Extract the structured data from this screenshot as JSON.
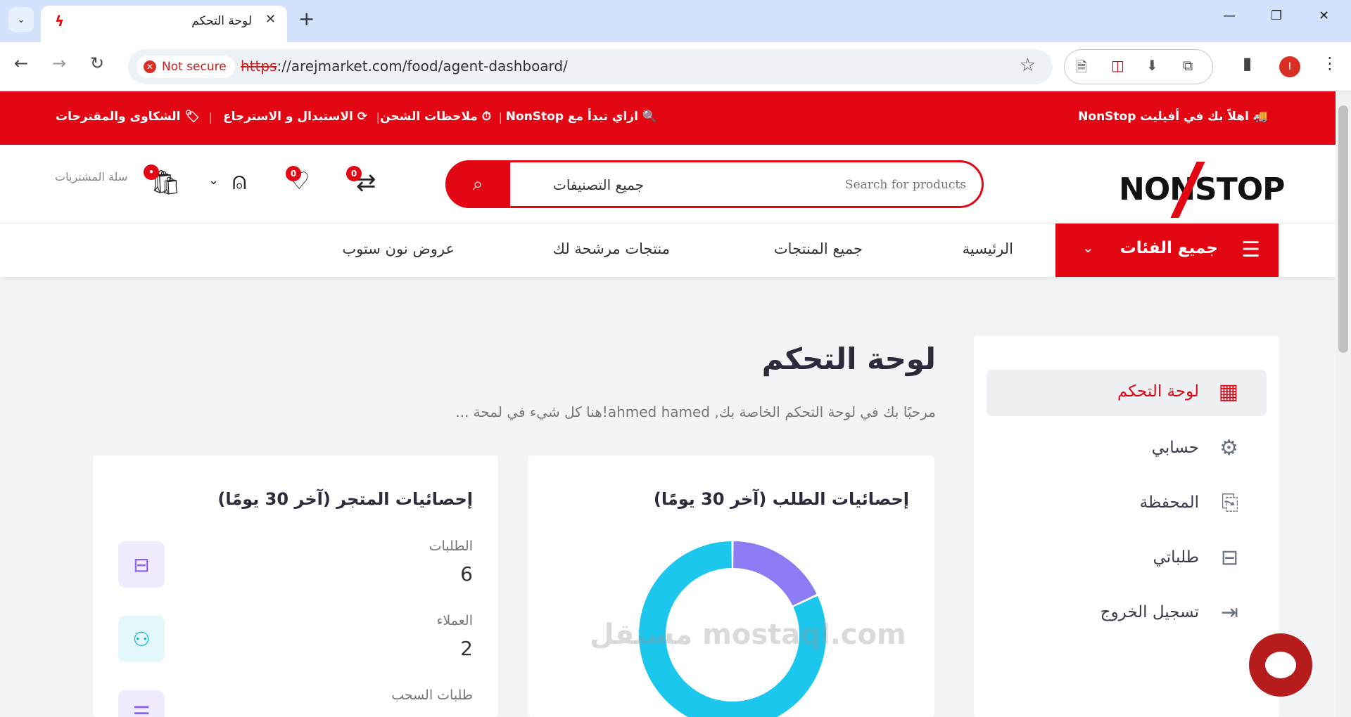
{
  "browser": {
    "tab_title": "لوحة التحكم",
    "not_secure": "Not secure",
    "url_scheme": "https",
    "url_rest": "://arejmarket.com/food/agent-dashboard/",
    "profile_initial": "I"
  },
  "topbar": {
    "welcome": "اهلاً بك في أفيليت NonStop",
    "links": [
      "ازاي تبدأ مع NonStop",
      "ملاحظات الشحن",
      "الاستبدال و الاسترجاع",
      "الشكاوى والمقترحات"
    ]
  },
  "header": {
    "logo": "NONSTOP",
    "search_category": "جميع التصنيفات",
    "search_placeholder": "Search for products",
    "compare_count": "0",
    "wishlist_count": "0",
    "cart_label": "سلة المشتريات"
  },
  "nav": {
    "all_categories": "جميع الفئات",
    "links": [
      "الرئيسية",
      "جميع المنتجات",
      "منتجات مرشحة لك",
      "عروض نون ستوب"
    ]
  },
  "sidebar": {
    "items": [
      {
        "label": "لوحة التحكم",
        "icon": "grid-icon"
      },
      {
        "label": "حسابي",
        "icon": "user-gear-icon"
      },
      {
        "label": "المحفظة",
        "icon": "wallet-icon"
      },
      {
        "label": "طلباتي",
        "icon": "bag-icon"
      },
      {
        "label": "تسجيل الخروج",
        "icon": "logout-icon"
      }
    ]
  },
  "dashboard": {
    "title": "لوحة التحكم",
    "subtitle": "مرحبًا بك في لوحة التحكم الخاصة بك, ahmed hamed!هنا كل شيء في لمحة ..."
  },
  "store_stats": {
    "title": "إحصائيات المتجر (آخر 30 يومًا)",
    "items": [
      {
        "label": "الطلبات",
        "value": "6",
        "icon": "bag-icon",
        "color": "#8b5cf6"
      },
      {
        "label": "العملاء",
        "value": "2",
        "icon": "users-icon",
        "color": "#06b6d4"
      },
      {
        "label": "طلبات السحب",
        "value": "",
        "icon": "server-icon",
        "color": "#8b5cf6"
      }
    ]
  },
  "order_stats": {
    "title": "إحصائيات الطلب (آخر 30 يومًا)"
  },
  "chart_data": {
    "type": "pie",
    "title": "",
    "slices": [
      {
        "name": "",
        "value": 18,
        "color": "#8b7cf6"
      },
      {
        "name": "",
        "value": 82,
        "color": "#1cc7ee"
      }
    ]
  },
  "watermark": "مستقل mostaql.com",
  "colors": {
    "brand": "#e30613",
    "accent_purple": "#8b5cf6",
    "accent_cyan": "#1cc7ee"
  }
}
